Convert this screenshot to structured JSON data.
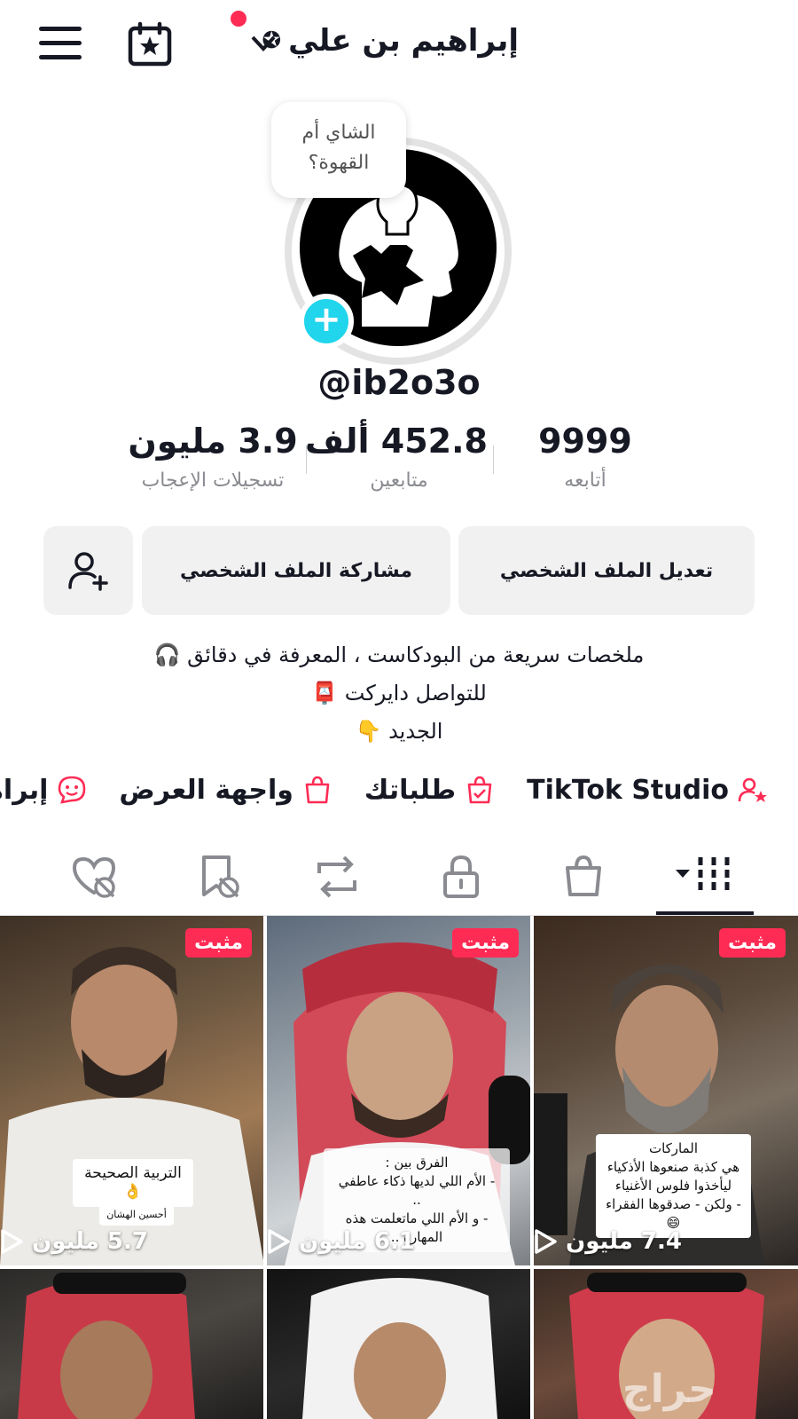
{
  "header": {
    "title": "إبراهيم بن علي",
    "title_star": "✪"
  },
  "avatar": {
    "bubble_line1": "الشاي أم",
    "bubble_line2": "القهوة؟",
    "plus": "+"
  },
  "handle": "@ib2o3o",
  "stats": [
    {
      "value": "3.9 مليون",
      "label": "تسجيلات الإعجاب"
    },
    {
      "value": "452.8 ألف",
      "label": "متابعين"
    },
    {
      "value": "9999",
      "label": "أتابعه"
    }
  ],
  "buttons": {
    "edit": "تعديل الملف الشخصي",
    "share": "مشاركة الملف الشخصي"
  },
  "bio": {
    "line1": "ملخصات سريعة من البودكاست ، المعرفة في دقائق 🎧",
    "line2": "للتواصل دايركت 📮",
    "line3": "الجديد 👇"
  },
  "links": [
    {
      "label": "TikTok Studio",
      "icon": "person-star-icon"
    },
    {
      "label": "طلباتك",
      "icon": "order-bag-icon"
    },
    {
      "label": "واجهة العرض",
      "icon": "shopping-bag-icon"
    },
    {
      "label": "إبراهيم",
      "icon": "face-bubble-icon"
    }
  ],
  "tabs": [
    "videos-grid-icon",
    "shop-bag-icon",
    "lock-icon",
    "repost-icon",
    "favorites-hidden-icon",
    "liked-hidden-icon"
  ],
  "videos": [
    {
      "pinned": "مثبت",
      "views": "7.4 مليون",
      "caption": [
        "الماركات",
        "هي كذبة صنعوها الأذكياء",
        "ليأخذوا فلوس الأغنياء",
        "- ولكن - صدقوها الفقراء 😄"
      ]
    },
    {
      "pinned": "مثبت",
      "views": "6.1 مليون",
      "caption": [
        "الفرق بين :",
        "- الأم اللي لديها ذكاء عاطفي ..",
        "- و الأم اللي ماتعلمت هذه المهارة .."
      ]
    },
    {
      "pinned": "مثبت",
      "views": "5.7 مليون",
      "caption": [
        "التربية الصحيحة 👌",
        "أحسين الهشان"
      ]
    },
    {
      "pinned": "",
      "views": "",
      "caption": []
    },
    {
      "pinned": "",
      "views": "",
      "caption": []
    },
    {
      "pinned": "",
      "views": "",
      "caption": []
    }
  ],
  "watermark": "حراج",
  "colors": {
    "accent": "#fe2c55",
    "badge": "#20d5ec"
  }
}
